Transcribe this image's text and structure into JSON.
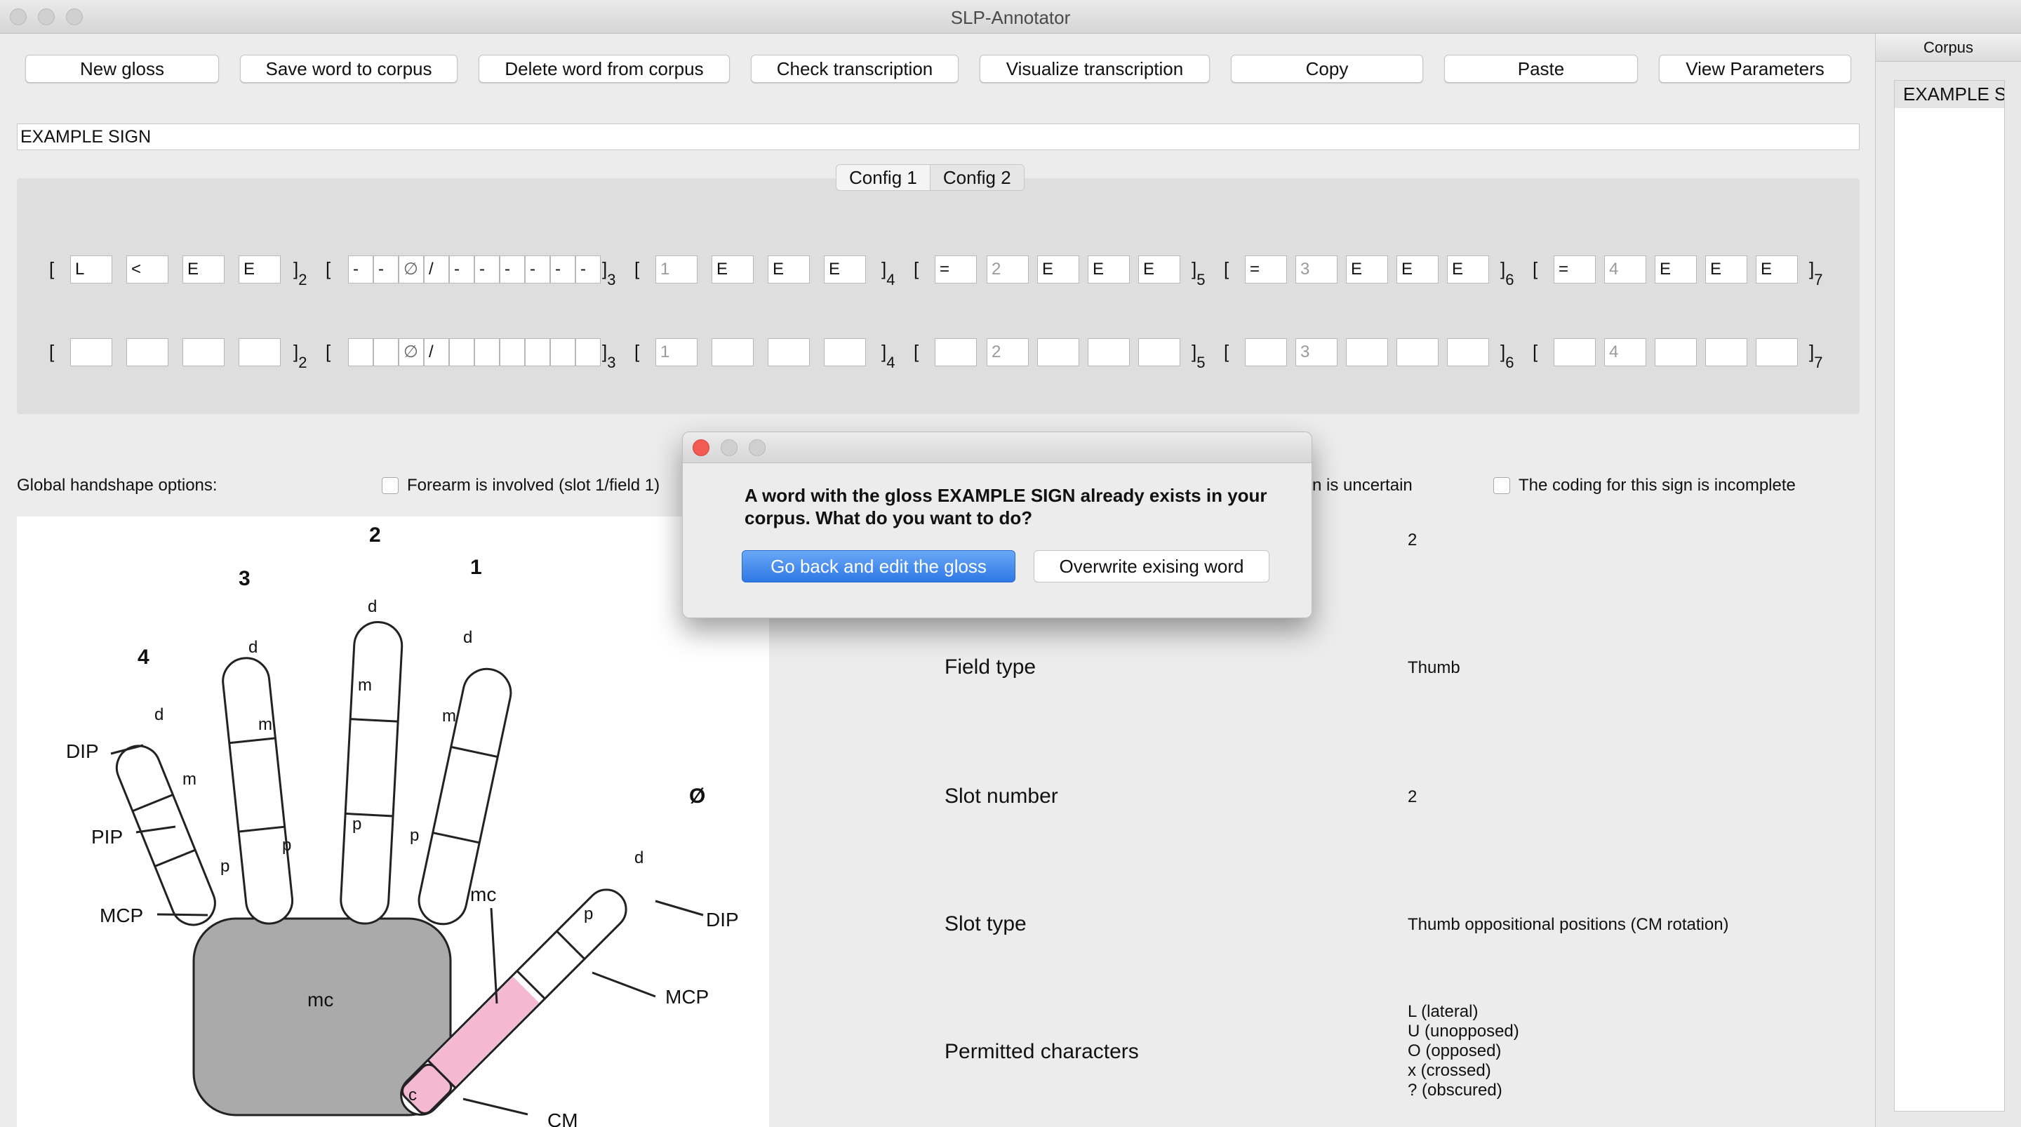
{
  "window": {
    "title": "SLP-Annotator"
  },
  "toolbar": {
    "new_gloss": "New gloss",
    "save_word": "Save word to corpus",
    "delete_word": "Delete word from corpus",
    "check": "Check transcription",
    "visualize": "Visualize transcription",
    "copy": "Copy",
    "paste": "Paste",
    "view_params": "View Parameters"
  },
  "gloss": {
    "value": "EXAMPLE SIGN"
  },
  "config_tabs": [
    "Config 1",
    "Config 2"
  ],
  "config1": {
    "f1": [
      "L",
      "<",
      "E",
      "E"
    ],
    "f2": [
      "-",
      "-",
      "∅",
      "/",
      "-",
      "-",
      "-",
      "-",
      "-",
      "-"
    ],
    "f3": [
      "1",
      "E",
      "E",
      "E"
    ],
    "f4": [
      "=",
      "2",
      "E",
      "E",
      "E"
    ],
    "f5": [
      "=",
      "3",
      "E",
      "E",
      "E"
    ],
    "f6": [
      "=",
      "4",
      "E",
      "E",
      "E"
    ]
  },
  "config2": {
    "f2": [
      "∅",
      "/"
    ],
    "f3": [
      "1"
    ],
    "f4": [
      "2"
    ],
    "f5": [
      "3"
    ],
    "f6": [
      "4"
    ]
  },
  "bracket": {
    "open": "[",
    "close": "]",
    "subs": [
      "2",
      "3",
      "4",
      "5",
      "6",
      "7"
    ]
  },
  "options": {
    "global_label": "Global handshape options:",
    "forearm": "Forearm is involved (slot 1/field 1)",
    "uncertain": "n is uncertain",
    "incomplete": "The coding for this sign is incomplete"
  },
  "hand": {
    "fingers": [
      "1",
      "2",
      "3",
      "4",
      "Ø"
    ],
    "joints": [
      "DIP",
      "PIP",
      "MCP",
      "DIP",
      "MCP",
      "CM"
    ],
    "segments": [
      "d",
      "m",
      "p",
      "mc",
      "c"
    ]
  },
  "info": {
    "field_number": "2",
    "field_type_label": "Field type",
    "field_type": "Thumb",
    "slot_number_label": "Slot number",
    "slot_number": "2",
    "slot_type_label": "Slot type",
    "slot_type": "Thumb oppositional positions (CM rotation)",
    "permitted_label": "Permitted characters",
    "permitted": [
      "L (lateral)",
      "U (unopposed)",
      "O (opposed)",
      "x (crossed)",
      "? (obscured)"
    ]
  },
  "corpus": {
    "header": "Corpus",
    "items": [
      "EXAMPLE S"
    ]
  },
  "dialog": {
    "message": "A word with the gloss EXAMPLE SIGN already exists in your corpus. What do you want to do?",
    "primary": "Go back and edit the gloss",
    "secondary": "Overwrite exising word"
  },
  "colors": {
    "accent": "#3d86e8",
    "highlight": "#f4b8d0",
    "palm": "#aaaaaa"
  }
}
